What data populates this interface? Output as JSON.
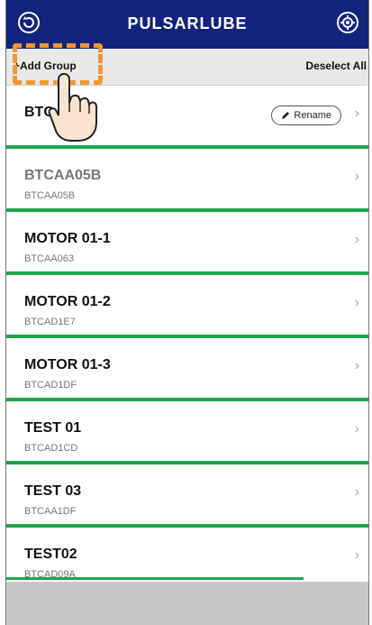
{
  "header": {
    "logo": "PULSARLUBE"
  },
  "toolbar": {
    "add_group": "+Add Group",
    "deselect_all": "Deselect All"
  },
  "rename_label": "Rename",
  "devices": [
    {
      "name": "BTC",
      "id": ""
    },
    {
      "name": "BTCAA05B",
      "id": "BTCAA05B"
    },
    {
      "name": "MOTOR 01-1",
      "id": "BTCAA063"
    },
    {
      "name": "MOTOR 01-2",
      "id": "BTCAD1E7"
    },
    {
      "name": "MOTOR 01-3",
      "id": "BTCAD1DF"
    },
    {
      "name": "TEST 01",
      "id": "BTCAD1CD"
    },
    {
      "name": "TEST 03",
      "id": "BTCAA1DF"
    },
    {
      "name": "TEST02",
      "id": "BTCAD09A"
    }
  ],
  "colors": {
    "header": "#12237e",
    "divider": "#1ea54a",
    "highlight": "#f3962e"
  }
}
